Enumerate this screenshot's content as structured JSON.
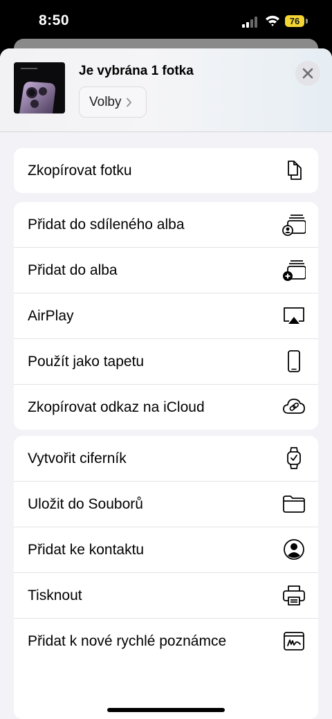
{
  "status_bar": {
    "time": "8:50",
    "battery_level": "76",
    "battery_color": "#f3d533",
    "icons": [
      "signal-icon",
      "wifi-icon",
      "battery-icon"
    ]
  },
  "header": {
    "title": "Je vybrána 1 fotka",
    "options_label": "Volby",
    "close_icon": "close-icon"
  },
  "groups": [
    {
      "items": [
        {
          "label": "Zkopírovat fotku",
          "icon": "copy-icon"
        }
      ]
    },
    {
      "items": [
        {
          "label": "Přidat do sdíleného alba",
          "icon": "shared-album-icon"
        },
        {
          "label": "Přidat do alba",
          "icon": "add-album-icon"
        },
        {
          "label": "AirPlay",
          "icon": "airplay-icon"
        },
        {
          "label": "Použít jako tapetu",
          "icon": "phone-icon"
        },
        {
          "label": "Zkopírovat odkaz na iCloud",
          "icon": "icloud-link-icon"
        }
      ]
    },
    {
      "items": [
        {
          "label": "Vytvořit ciferník",
          "icon": "watch-icon"
        },
        {
          "label": "Uložit do Souborů",
          "icon": "folder-icon"
        },
        {
          "label": "Přidat ke kontaktu",
          "icon": "contact-icon"
        },
        {
          "label": "Tisknout",
          "icon": "printer-icon"
        },
        {
          "label": "Přidat k nové rychlé poznámce",
          "icon": "quick-note-icon"
        }
      ]
    }
  ]
}
